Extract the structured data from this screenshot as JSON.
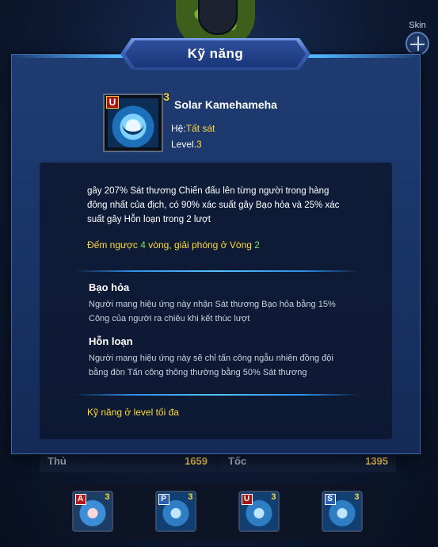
{
  "background": {
    "side_buttons": [
      {
        "label": "Skin",
        "icon": "shirt-icon"
      },
      {
        "label": "",
        "icon": "crosshair-icon"
      }
    ],
    "stats": [
      {
        "label": "Thủ",
        "value": "1659"
      },
      {
        "label": "Tốc",
        "value": "1395"
      }
    ],
    "skill_bar": [
      {
        "type": "A",
        "level": "3"
      },
      {
        "type": "P",
        "level": "3"
      },
      {
        "type": "U",
        "level": "3"
      },
      {
        "type": "S",
        "level": "3"
      }
    ]
  },
  "dialog": {
    "title": "Kỹ năng",
    "skill": {
      "type_tag": "U",
      "level_tag": "3",
      "name": "Solar Kamehameha",
      "element_label": "Hệ:",
      "element_value": "Tất sát",
      "level_label": "Level.",
      "level_value": "3"
    },
    "description": "gây 207% Sát thương Chiến đấu lên từng người trong hàng đông nhất của địch, có 90% xác suất gây Bạo hỏa và 25% xác suất gây Hỗn loạn trong 2 lượt",
    "countdown": {
      "prefix": "Đếm ngược ",
      "turns": "4",
      "middle": " vòng, giải phóng ở Vòng ",
      "round": "2"
    },
    "effects": [
      {
        "name": "Bạo hỏa",
        "description": "Người mang hiệu ứng này nhận Sát thương Bạo hỏa bằng 15% Công của người ra chiêu khi kết thúc lượt"
      },
      {
        "name": "Hỗn loạn",
        "description": "Người mang hiệu ứng này sẽ chỉ tấn công ngẫu nhiên đồng đội bằng đòn Tấn công thông thường bằng 50% Sát thương"
      }
    ],
    "max_level_note": "Kỹ năng ở level tối đa"
  },
  "colors": {
    "accent_yellow": "#ffd93a",
    "accent_green": "#6fe35c",
    "panel_blue": "#1f3c72"
  }
}
